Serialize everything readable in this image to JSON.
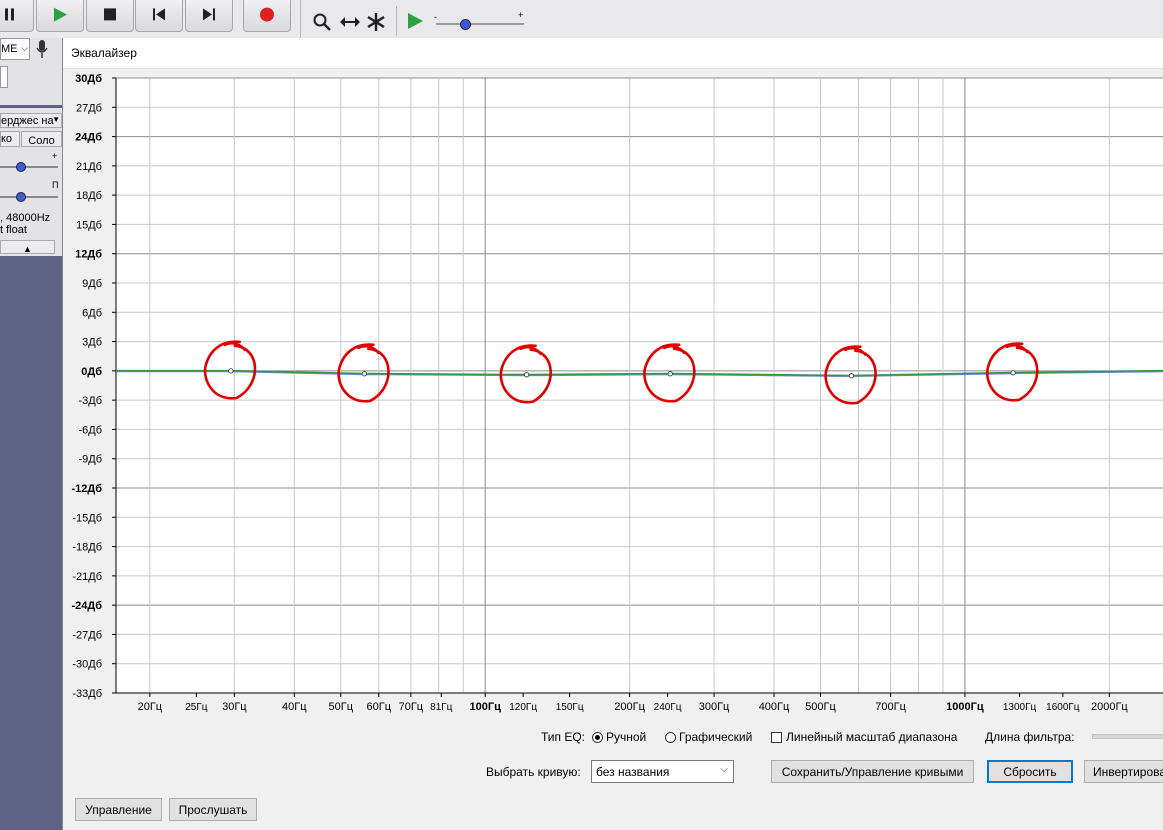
{
  "left_panel": {
    "dropdown_text": "МЕ",
    "track_name": "ерджес на",
    "mute_label": "ко",
    "solo_label": "Соло",
    "gain_plus": "+",
    "pan_right": "П",
    "format_line1": ", 48000Hz",
    "format_line2": "t float"
  },
  "dialog": {
    "title": "Эквалайзер"
  },
  "graph": {
    "db_labels": [
      "30Дб",
      "27Дб",
      "24Дб",
      "21Дб",
      "18Дб",
      "15Дб",
      "12Дб",
      "9Дб",
      "6Дб",
      "3Дб",
      "0Дб",
      "-3Дб",
      "-6Дб",
      "-9Дб",
      "-12Дб",
      "-15Дб",
      "-18Дб",
      "-21Дб",
      "-24Дб",
      "-27Дб",
      "-30Дб",
      "-33Дб"
    ],
    "db_bold": [
      "30Дб",
      "24Дб",
      "12Дб",
      "0Дб",
      "-12Дб",
      "-24Дб"
    ],
    "hz_labels": [
      "20Гц",
      "25Гц",
      "30Гц",
      "40Гц",
      "50Гц",
      "60Гц",
      "70Гц",
      "81Гц",
      "100Гц",
      "120Гц",
      "150Гц",
      "200Гц",
      "240Гц",
      "300Гц",
      "400Гц",
      "500Гц",
      "700Гц",
      "1000Гц",
      "1300Гц",
      "1600Гц",
      "2000Гц"
    ],
    "hz_small": [
      "25Гц",
      "81Гц",
      "120Гц",
      "150Гц",
      "240Гц",
      "1300Гц",
      "1600Гц"
    ],
    "hz_bold": [
      "100Гц",
      "1000Гц"
    ],
    "curve_color": "#3a8f52",
    "annotation_color": "#e00000",
    "control_points_db": [
      0,
      -0.3,
      -0.4,
      -0.3,
      -0.5,
      -0.2
    ]
  },
  "controls": {
    "eq_type_label": "Тип EQ:",
    "radio_manual": "Ручной",
    "radio_graphic": "Графический",
    "linear_scale_label": "Линейный масштаб диапазона",
    "filter_length_label": "Длина фильтра:",
    "select_curve_label": "Выбрать кривую:",
    "curve_value": "без названия",
    "save_manage_button": "Сохранить/Управление кривыми",
    "reset_button": "Сбросить",
    "invert_button": "Инвертирова",
    "manage_button": "Управление",
    "preview_button": "Прослушать"
  }
}
